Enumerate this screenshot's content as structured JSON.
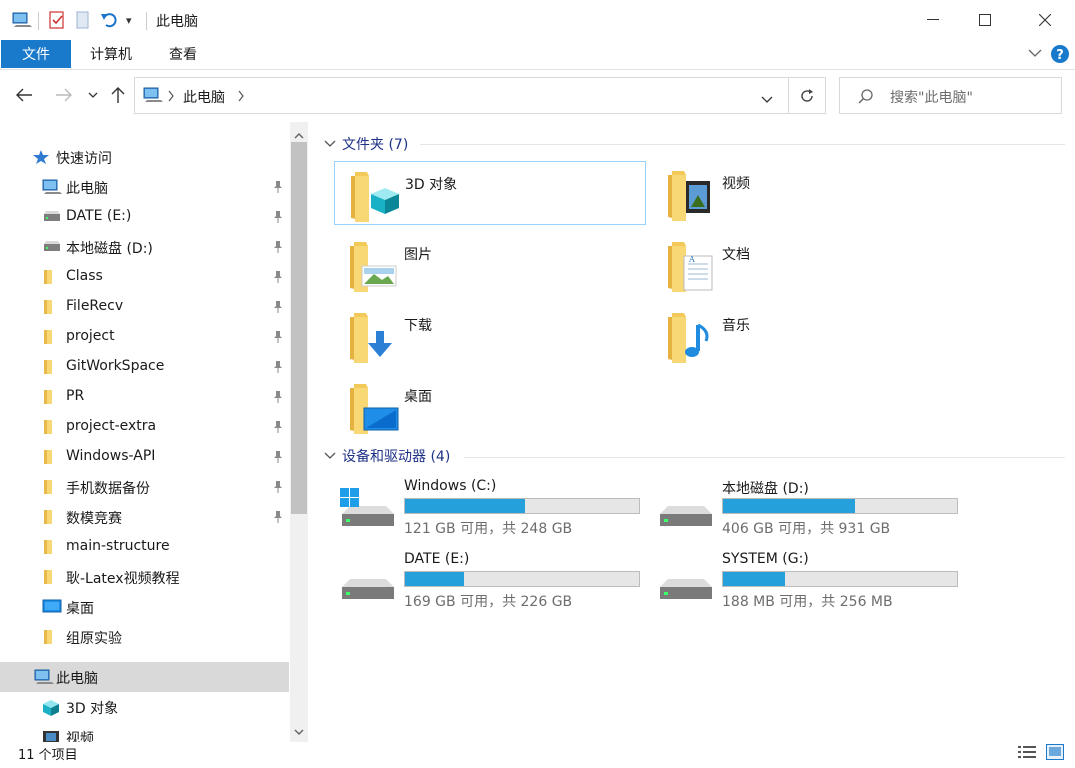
{
  "window": {
    "title": "此电脑",
    "quick_access_more": "▾"
  },
  "ribbon": {
    "tabs": [
      "文件",
      "计算机",
      "查看"
    ]
  },
  "address": {
    "path": "此电脑",
    "search_placeholder": "搜索\"此电脑\""
  },
  "sidebar": {
    "items": [
      {
        "label": "快速访问",
        "icon": "star-icon",
        "pinned": false
      },
      {
        "label": "此电脑",
        "icon": "computer-icon",
        "pinned": true
      },
      {
        "label": "DATE (E:)",
        "icon": "drive-icon",
        "pinned": true
      },
      {
        "label": "本地磁盘 (D:)",
        "icon": "drive-icon",
        "pinned": true
      },
      {
        "label": "Class",
        "icon": "folder-icon",
        "pinned": true
      },
      {
        "label": "FileRecv",
        "icon": "folder-icon",
        "pinned": true
      },
      {
        "label": "project",
        "icon": "folder-icon",
        "pinned": true
      },
      {
        "label": "GitWorkSpace",
        "icon": "folder-icon",
        "pinned": true
      },
      {
        "label": "PR",
        "icon": "folder-icon",
        "pinned": true
      },
      {
        "label": "project-extra",
        "icon": "folder-icon",
        "pinned": true
      },
      {
        "label": "Windows-API",
        "icon": "folder-icon",
        "pinned": true
      },
      {
        "label": "手机数据备份",
        "icon": "folder-icon",
        "pinned": true
      },
      {
        "label": "数模竞赛",
        "icon": "folder-icon",
        "pinned": true
      },
      {
        "label": "main-structure",
        "icon": "folder-icon",
        "pinned": false
      },
      {
        "label": "耿-Latex视频教程",
        "icon": "folder-icon",
        "pinned": false
      },
      {
        "label": "桌面",
        "icon": "desktop-icon",
        "pinned": false
      },
      {
        "label": "组原实验",
        "icon": "folder-icon",
        "pinned": false
      },
      {
        "label": "此电脑",
        "icon": "computer-icon",
        "pinned": false,
        "selected": true
      },
      {
        "label": "3D 对象",
        "icon": "3d-objects-icon",
        "pinned": false
      },
      {
        "label": "视频",
        "icon": "video-icon",
        "pinned": false
      }
    ]
  },
  "content": {
    "folders_header": "文件夹 (7)",
    "folders": [
      "3D 对象",
      "视频",
      "图片",
      "文档",
      "下载",
      "音乐",
      "桌面"
    ],
    "drives_header": "设备和驱动器 (4)",
    "drives": [
      {
        "name": "Windows (C:)",
        "caption": "121 GB 可用，共 248 GB",
        "used_fraction": 0.512
      },
      {
        "name": "本地磁盘 (D:)",
        "caption": "406 GB 可用，共 931 GB",
        "used_fraction": 0.564
      },
      {
        "name": "DATE (E:)",
        "caption": "169 GB 可用，共 226 GB",
        "used_fraction": 0.252
      },
      {
        "name": "SYSTEM (G:)",
        "caption": "188 MB 可用，共 256 MB",
        "used_fraction": 0.266
      }
    ]
  },
  "status": {
    "item_count": "11 个项目"
  },
  "colors": {
    "accent": "#1979ca",
    "bar_fill": "#26a0da",
    "group_header": "#1e3287",
    "folder": "#f8d775"
  }
}
